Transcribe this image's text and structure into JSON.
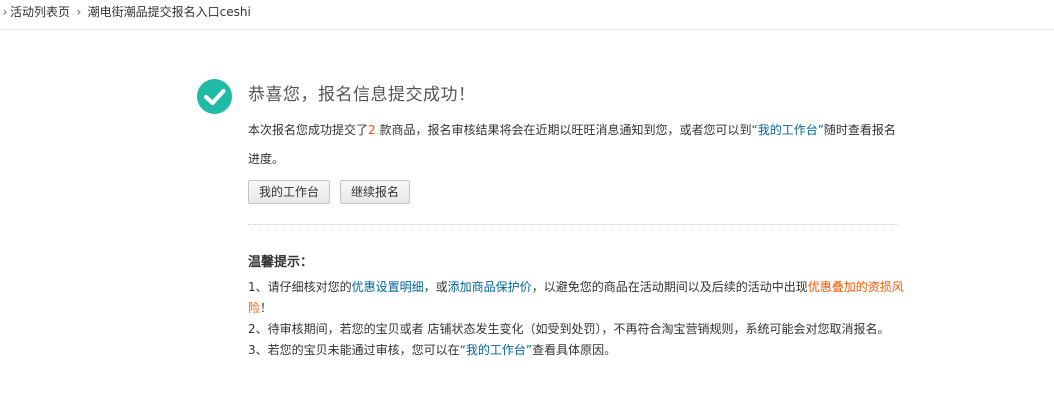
{
  "breadcrumb": {
    "items": [
      "活动列表页",
      "潮电街潮品提交报名入口ceshi"
    ]
  },
  "success": {
    "icon": "check-circle-icon",
    "icon_color": "#1fbba6",
    "title": "恭喜您，报名信息提交成功！",
    "desc_before_count": "本次报名您成功提交了",
    "count": "2",
    "desc_after_count": " 款商品，报名审核结果将会在近期以旺旺消息通知到您，或者您可以到",
    "workbench_link": "“我的工作台”",
    "desc_end": "随时查看报名进度。"
  },
  "buttons": {
    "workbench": "我的工作台",
    "continue": "继续报名"
  },
  "tips": {
    "title": "温馨提示：",
    "tip1": {
      "prefix": "1、请仔细核对您的",
      "link1": "优惠设置明细",
      "middle": "，或",
      "link2": "添加商品保护价",
      "text": "，以避免您的商品在活动期间以及后续的活动中出现",
      "warning": "优惠叠加的资损风险",
      "end": "！"
    },
    "tip2": "2、待审核期间，若您的宝贝或者 店铺状态发生变化（如受到处罚），不再符合淘宝营销规则，系统可能会对您取消报名。",
    "tip3": {
      "prefix": "3、若您的宝贝未能通过审核，您可以在",
      "link": "“我的工作台”",
      "suffix": "查看具体原因。"
    }
  },
  "colors": {
    "link": "#006699",
    "highlight": "#ff5500",
    "success_green": "#1fbba6"
  }
}
